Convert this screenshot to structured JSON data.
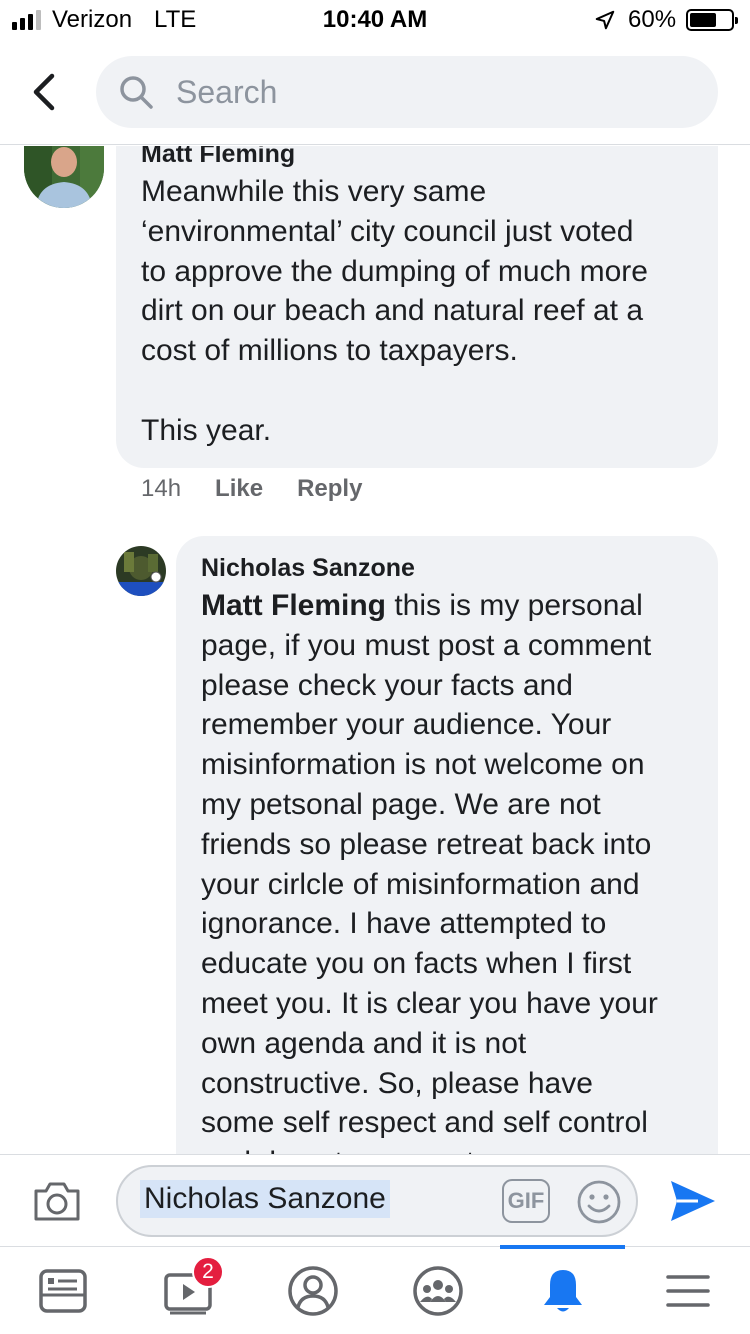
{
  "status_bar": {
    "carrier": "Verizon",
    "network": "LTE",
    "time": "10:40 AM",
    "battery": "60%",
    "battery_level": 0.6,
    "signal_bars": 3,
    "signal_bars_total": 4
  },
  "header": {
    "search_placeholder": "Search"
  },
  "comments": [
    {
      "author": "Matt Fleming",
      "text": "Meanwhile this very same\n‘environmental’ city council just voted\nto approve the dumping of much more\ndirt on our beach and natural reef at a\ncost of millions to taxpayers.\n\nThis year.",
      "time": "14h",
      "like_label": "Like",
      "reply_label": "Reply"
    },
    {
      "author": "Nicholas Sanzone",
      "mention": "Matt Fleming",
      "text": " this is my personal\npage, if you must post a comment\nplease check your facts and\nremember your audience. Your\nmisinformation is not welcome on\nmy petsonal page. We are not\nfriends so please retreat back into\nyour cirlcle of misinformation and\nignorance. I have attempted to\neducate you on facts when I first\nmeet you. It is clear you have your\nown agenda and it is not\nconstructive. So, please have\nsome self respect and self control\nand do not comment"
    }
  ],
  "composer": {
    "mention_chip": "Nicholas Sanzone",
    "gif_label": "GIF"
  },
  "tabbar": {
    "video_badge": "2"
  },
  "colors": {
    "accent": "#1877f2",
    "bubble": "#f0f2f5",
    "badge": "#e41e3f",
    "secondary_text": "#65676b"
  },
  "icons": [
    "back-chevron-icon",
    "search-icon",
    "location-arrow-icon",
    "camera-icon",
    "gif-icon",
    "emoji-icon",
    "send-icon",
    "news-feed-icon",
    "watch-video-icon",
    "profile-icon",
    "groups-icon",
    "notifications-bell-icon",
    "menu-icon"
  ]
}
